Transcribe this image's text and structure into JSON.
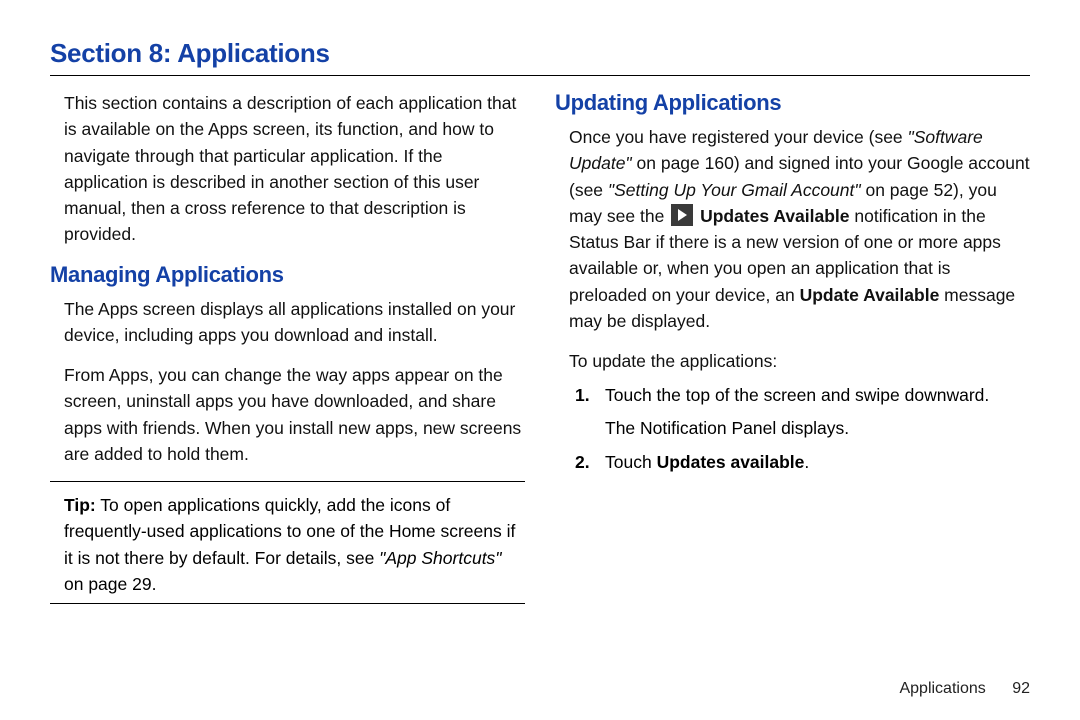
{
  "section_title": "Section 8:  Applications",
  "left": {
    "intro": "This section contains a description of each application that is available on the Apps screen, its function, and how to navigate through that particular application. If the application is described in another section of this user manual, then a cross reference to that description is provided.",
    "managing_heading": "Managing Applications",
    "managing_p1": "The Apps screen displays all applications installed on your device, including apps you download and install.",
    "managing_p2": "From Apps, you can change the way apps appear on the screen, uninstall apps you have downloaded, and share apps with friends. When you install new apps, new screens are added to hold them.",
    "tip_label": "Tip:",
    "tip_text_1": " To open applications quickly, add the icons of frequently-used applications to one of the Home screens if it is not there by default. For details, see ",
    "tip_ref": "\"App Shortcuts\"",
    "tip_text_2": " on page 29."
  },
  "right": {
    "updating_heading": "Updating Applications",
    "p1_a": "Once you have registered your device (see ",
    "p1_ref1": "\"Software Update\"",
    "p1_b": " on page 160) and signed into your Google account (see ",
    "p1_ref2": "\"Setting Up Your Gmail Account\"",
    "p1_c": " on page 52), you may see the ",
    "p1_bold1": "Updates Available",
    "p1_d": " notification in the Status Bar if there is a new version of one or more apps available or, when you open an application that is preloaded on your device, an ",
    "p1_bold2": "Update Available",
    "p1_e": " message may be displayed.",
    "p2": "To update the applications:",
    "step1_a": "Touch the top of the screen and swipe downward.",
    "step1_b": "The Notification Panel displays.",
    "step2_a": "Touch ",
    "step2_bold": "Updates available",
    "step2_b": "."
  },
  "footer": {
    "chapter": "Applications",
    "page": "92"
  }
}
